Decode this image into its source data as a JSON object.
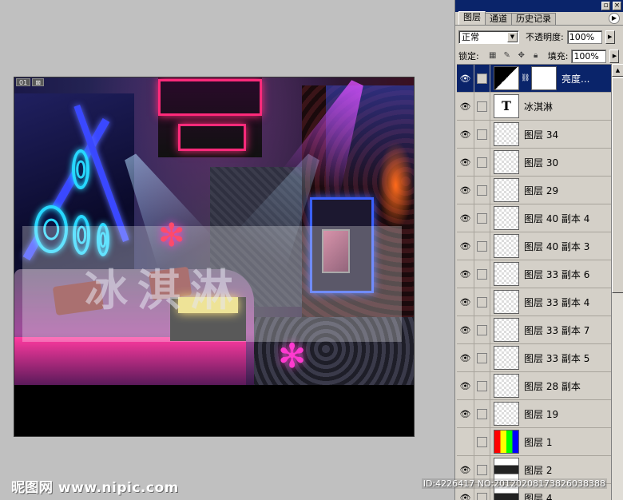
{
  "document": {
    "badges": [
      "01",
      "⊠"
    ],
    "watermark_text": "冰淇淋"
  },
  "panel": {
    "tabs": [
      "图层",
      "通道",
      "历史记录"
    ],
    "blend_mode": "正常",
    "opacity_label": "不透明度:",
    "opacity_value": "100%",
    "lock_label": "锁定:",
    "fill_label": "填充:",
    "fill_value": "100%",
    "layers": [
      {
        "name": "亮度...",
        "thumb": "adjustment",
        "visible": true,
        "selected": true
      },
      {
        "name": "冰淇淋",
        "thumb": "text",
        "visible": true,
        "selected": false
      },
      {
        "name": "图层 34",
        "thumb": "transparent",
        "visible": true,
        "selected": false
      },
      {
        "name": "图层 30",
        "thumb": "transparent",
        "visible": true,
        "selected": false
      },
      {
        "name": "图层 29",
        "thumb": "transparent",
        "visible": true,
        "selected": false
      },
      {
        "name": "图层 40 副本 4",
        "thumb": "transparent",
        "visible": true,
        "selected": false
      },
      {
        "name": "图层 40 副本 3",
        "thumb": "transparent",
        "visible": true,
        "selected": false
      },
      {
        "name": "图层 33 副本 6",
        "thumb": "transparent",
        "visible": true,
        "selected": false
      },
      {
        "name": "图层 33 副本 4",
        "thumb": "transparent",
        "visible": true,
        "selected": false
      },
      {
        "name": "图层 33 副本 7",
        "thumb": "transparent",
        "visible": true,
        "selected": false
      },
      {
        "name": "图层 33 副本 5",
        "thumb": "transparent",
        "visible": true,
        "selected": false
      },
      {
        "name": "图层 28 副本",
        "thumb": "transparent",
        "visible": true,
        "selected": false
      },
      {
        "name": "图层 19",
        "thumb": "transparent",
        "visible": true,
        "selected": false
      },
      {
        "name": "图层 1",
        "thumb": "color",
        "visible": false,
        "selected": false
      },
      {
        "name": "图层 2",
        "thumb": "dark",
        "visible": true,
        "selected": false
      },
      {
        "name": "图层 4",
        "thumb": "dark",
        "visible": true,
        "selected": false
      }
    ]
  },
  "footer": {
    "site": "昵图网 www.nipic.com",
    "id": "ID:4226417 NO:20120208173826038388"
  },
  "icons": {
    "eye": "eye-icon",
    "chain": "chain-link-icon",
    "panel_menu": "panel-menu-arrow-icon"
  }
}
